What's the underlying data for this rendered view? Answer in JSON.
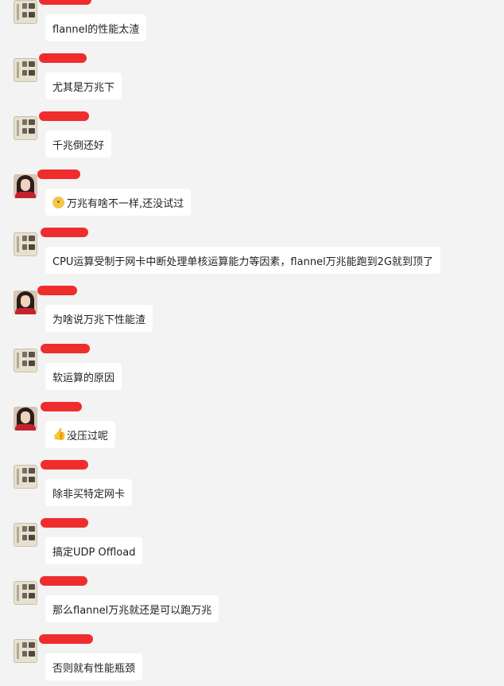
{
  "messages": [
    {
      "avatar": "calligraphy-avatar",
      "text": "flannel的性能太渣"
    },
    {
      "avatar": "calligraphy-avatar",
      "text": "尤其是万兆下"
    },
    {
      "avatar": "calligraphy-avatar",
      "text": "千兆倒还好"
    },
    {
      "avatar": "photo-avatar",
      "emoji": "sweat-smile-emoji",
      "text": "万兆有啥不一样,还没试过"
    },
    {
      "avatar": "calligraphy-avatar",
      "text": "CPU运算受制于网卡中断处理单核运算能力等因素，flannel万兆能跑到2G就到顶了"
    },
    {
      "avatar": "photo-avatar",
      "text": "为啥说万兆下性能渣"
    },
    {
      "avatar": "calligraphy-avatar",
      "text": "软运算的原因"
    },
    {
      "avatar": "photo-avatar",
      "emoji": "thumbs-up-emoji",
      "text": "没压过呢"
    },
    {
      "avatar": "calligraphy-avatar",
      "text": "除非买特定网卡"
    },
    {
      "avatar": "calligraphy-avatar",
      "text": "搞定UDP Offload"
    },
    {
      "avatar": "calligraphy-avatar",
      "text": "那么flannel万兆就还是可以跑万兆"
    },
    {
      "avatar": "calligraphy-avatar",
      "text": "否则就有性能瓶颈"
    }
  ]
}
